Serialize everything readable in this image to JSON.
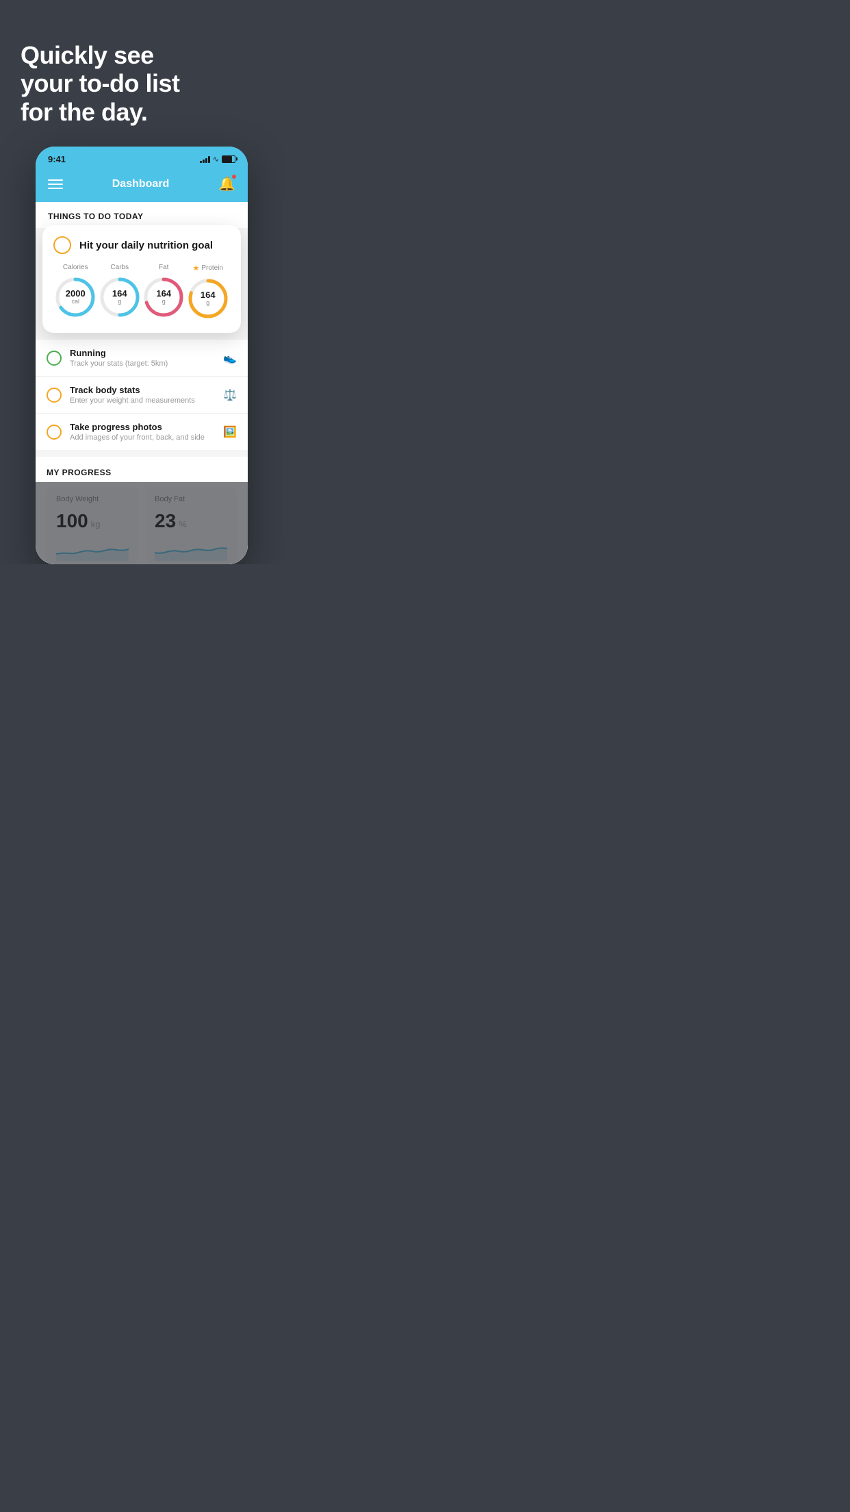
{
  "hero": {
    "line1": "Quickly see",
    "line2": "your to-do list",
    "line3": "for the day."
  },
  "statusBar": {
    "time": "9:41",
    "signalBars": [
      3,
      5,
      8,
      11,
      11
    ],
    "batteryPercent": 75
  },
  "nav": {
    "title": "Dashboard"
  },
  "thingsToday": {
    "heading": "THINGS TO DO TODAY"
  },
  "nutritionCard": {
    "title": "Hit your daily nutrition goal",
    "items": [
      {
        "label": "Calories",
        "value": "2000",
        "unit": "cal",
        "color": "#4ec3e8",
        "percent": 65
      },
      {
        "label": "Carbs",
        "value": "164",
        "unit": "g",
        "color": "#4ec3e8",
        "percent": 50
      },
      {
        "label": "Fat",
        "value": "164",
        "unit": "g",
        "color": "#e05a7a",
        "percent": 70
      },
      {
        "label": "Protein",
        "value": "164",
        "unit": "g",
        "color": "#f5a623",
        "percent": 80,
        "starred": true
      }
    ]
  },
  "todoItems": [
    {
      "title": "Running",
      "subtitle": "Track your stats (target: 5km)",
      "circleColor": "green",
      "icon": "👟"
    },
    {
      "title": "Track body stats",
      "subtitle": "Enter your weight and measurements",
      "circleColor": "yellow",
      "icon": "⚖️"
    },
    {
      "title": "Take progress photos",
      "subtitle": "Add images of your front, back, and side",
      "circleColor": "yellow",
      "icon": "🖼️"
    }
  ],
  "progress": {
    "heading": "MY PROGRESS",
    "cards": [
      {
        "title": "Body Weight",
        "value": "100",
        "unit": "kg"
      },
      {
        "title": "Body Fat",
        "value": "23",
        "unit": "%"
      }
    ]
  }
}
